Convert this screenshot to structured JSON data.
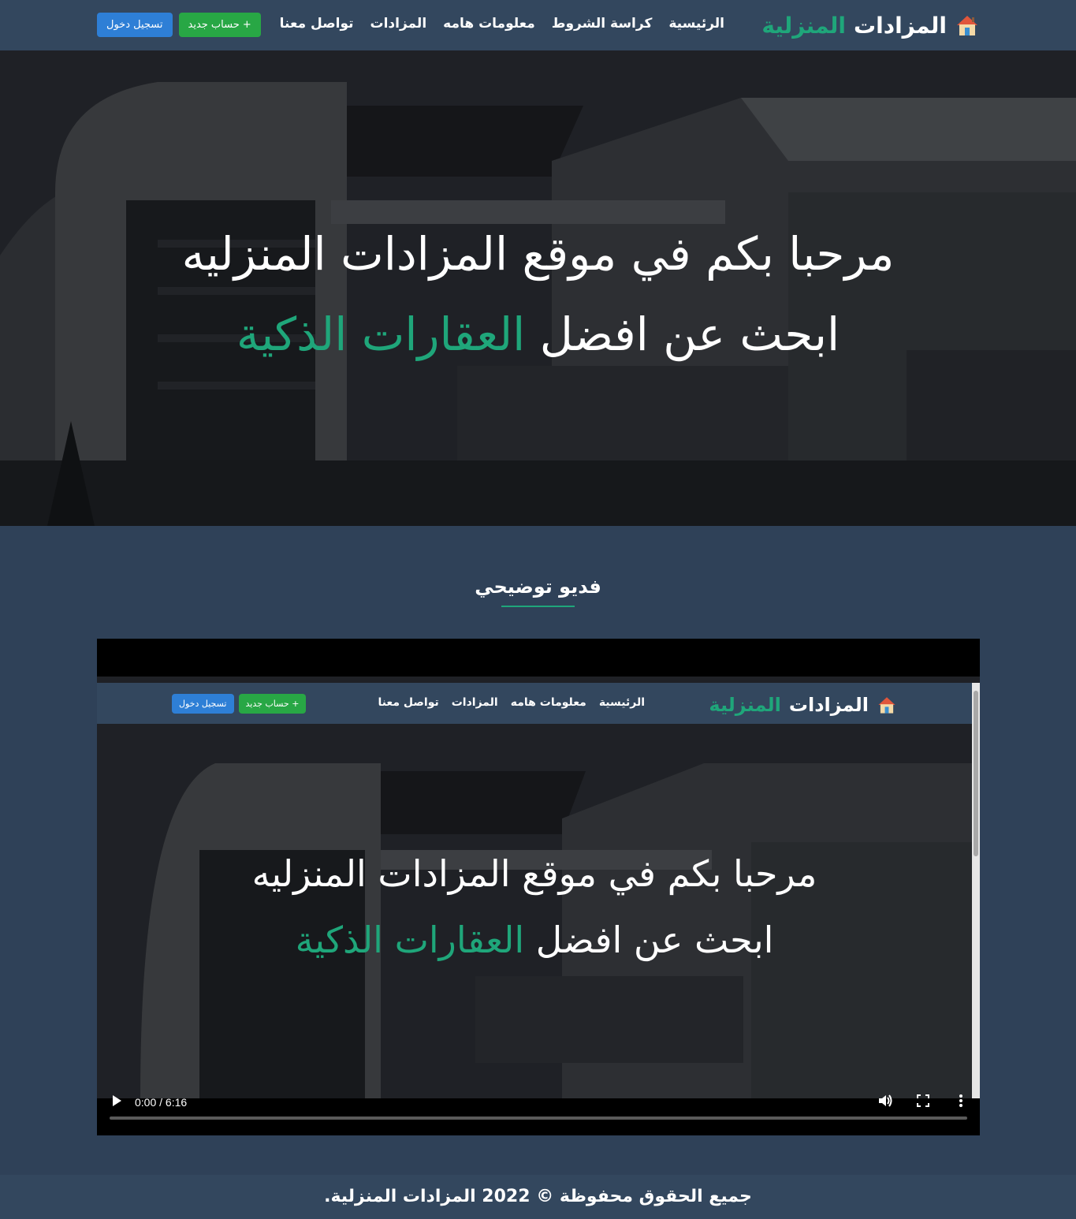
{
  "navbar": {
    "brand_part1": "المزادات",
    "brand_part2": "المنزلية",
    "links": [
      "الرئيسية",
      "كراسة الشروط",
      "معلومات هامه",
      "المزادات",
      "تواصل معنا"
    ],
    "login_label": "تسجيل دخول",
    "register_label": "+ حساب جديد"
  },
  "hero": {
    "line1": "مرحبا بكم في موقع المزادات المنزليه",
    "line2_prefix": "ابحث عن افضل",
    "line2_highlight": "العقارات الذكية"
  },
  "video_section": {
    "title": "فديو توضيحي",
    "time": "0:00 / 6:16",
    "preview": {
      "brand_part1": "المزادات",
      "brand_part2": "المنزلية",
      "links": [
        "الرئيسية",
        "معلومات هامه",
        "المزادات",
        "تواصل معنا"
      ],
      "login_label": "تسجيل دخول",
      "register_label": "+ حساب جديد",
      "line1": "مرحبا بكم في موقع المزادات المنزليه",
      "line2_prefix": "ابحث عن افضل",
      "line2_highlight": "العقارات الذكية"
    }
  },
  "footer": {
    "text": "جميع الحقوق محفوظة © 2022 المزادات المنزلية."
  },
  "colors": {
    "accent": "#1fa67a",
    "navbar": "#33475e",
    "page_bg": "#2f4158",
    "login_button": "#2e7fd6",
    "register_button": "#28a745"
  },
  "icons": [
    "house-logo-icon",
    "play-icon",
    "volume-icon",
    "fullscreen-icon",
    "more-options-icon"
  ]
}
